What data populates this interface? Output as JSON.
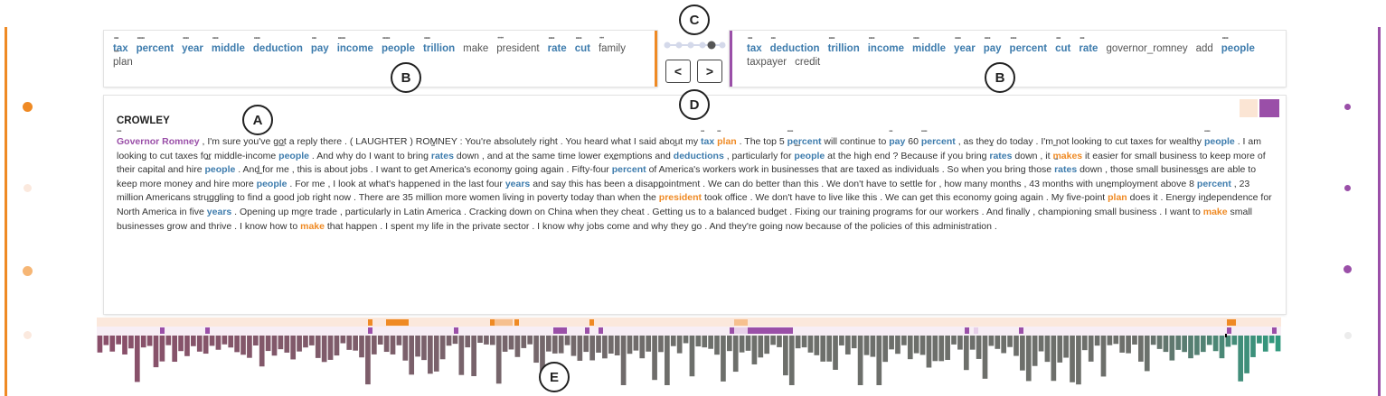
{
  "colors": {
    "orange": "#ef8a24",
    "purple": "#9a4fa8",
    "blue": "#3e7cad",
    "light_orange_bg": "#fbe5d4",
    "light_purple": "#e7cfe9",
    "bar_left": "#8a4f6a",
    "bar_mid": "#6d6f6b",
    "bar_right": "#2e9b7f"
  },
  "callouts": {
    "a": "A",
    "b_left": "B",
    "b_right": "B",
    "c": "C",
    "d": "D",
    "e": "E"
  },
  "left_keywords": [
    {
      "text": "tax",
      "style": "blue",
      "dots": "•••"
    },
    {
      "text": "percent",
      "style": "blue",
      "dots": "•••••"
    },
    {
      "text": "year",
      "style": "blue",
      "dots": "••••"
    },
    {
      "text": "middle",
      "style": "blue",
      "dots": "••••"
    },
    {
      "text": "deduction",
      "style": "blue",
      "dots": "••••"
    },
    {
      "text": "pay",
      "style": "blue",
      "dots": "•••"
    },
    {
      "text": "income",
      "style": "blue",
      "dots": "•••••"
    },
    {
      "text": "people",
      "style": "blue",
      "dots": "•••••"
    },
    {
      "text": "trillion",
      "style": "blue",
      "dots": "••••"
    },
    {
      "text": "make",
      "style": "gray",
      "dots": ""
    },
    {
      "text": "president",
      "style": "gray",
      "dots": "••••"
    },
    {
      "text": "rate",
      "style": "blue",
      "dots": "••••"
    },
    {
      "text": "cut",
      "style": "blue",
      "dots": "••••"
    },
    {
      "text": "family",
      "style": "gray",
      "dots": "•••"
    },
    {
      "text": "plan",
      "style": "gray",
      "dots": "•••"
    }
  ],
  "right_keywords": [
    {
      "text": "tax",
      "style": "blue",
      "dots": "•••"
    },
    {
      "text": "deduction",
      "style": "blue",
      "dots": "•••"
    },
    {
      "text": "trillion",
      "style": "blue",
      "dots": "••••"
    },
    {
      "text": "income",
      "style": "blue",
      "dots": "••••"
    },
    {
      "text": "middle",
      "style": "blue",
      "dots": "••••"
    },
    {
      "text": "year",
      "style": "blue",
      "dots": "••••"
    },
    {
      "text": "pay",
      "style": "blue",
      "dots": "••••"
    },
    {
      "text": "percent",
      "style": "blue",
      "dots": "••••"
    },
    {
      "text": "cut",
      "style": "blue",
      "dots": "•••"
    },
    {
      "text": "rate",
      "style": "blue",
      "dots": "•••"
    },
    {
      "text": "governor_romney",
      "style": "gray",
      "dots": ""
    },
    {
      "text": "add",
      "style": "gray",
      "dots": ""
    },
    {
      "text": "people",
      "style": "blue",
      "dots": "••••"
    },
    {
      "text": "taxpayer",
      "style": "gray",
      "dots": ""
    },
    {
      "text": "credit",
      "style": "gray",
      "dots": ""
    }
  ],
  "nav": {
    "prev_label": "<",
    "next_label": ">"
  },
  "speaker": "CROWLEY",
  "transcript": [
    {
      "t": "Governor Romney",
      "s": "purple",
      "dots": "••••"
    },
    {
      "t": " , I'm sure you've got a reply there . ( LAUGHTER ) ROMNEY : You're absolutely right . You heard what I said about my "
    },
    {
      "t": "tax",
      "s": "blue",
      "dots": "•••"
    },
    {
      "t": "  "
    },
    {
      "t": "plan",
      "s": "orange",
      "dots": "•••"
    },
    {
      "t": "  . The top 5 "
    },
    {
      "t": "percent",
      "s": "blue",
      "dots": "•••••"
    },
    {
      "t": " will continue to "
    },
    {
      "t": "pay",
      "s": "blue",
      "dots": "•••"
    },
    {
      "t": "  60 "
    },
    {
      "t": "percent",
      "s": "blue",
      "dots": "•••••"
    },
    {
      "t": " , as they do today . I'm not looking to cut taxes for wealthy "
    },
    {
      "t": "people",
      "s": "blue",
      "dots": "•••••"
    },
    {
      "t": " . I am looking to cut taxes for middle-income "
    },
    {
      "t": "people",
      "s": "blue",
      "dots": "•••••"
    },
    {
      "t": " . And why do I want to bring "
    },
    {
      "t": "rates",
      "s": "blue",
      "dots": "•••"
    },
    {
      "t": "  down , and at the same time lower exemptions and "
    },
    {
      "t": "deductions",
      "s": "blue",
      "dots": "•••"
    },
    {
      "t": " , particularly for "
    },
    {
      "t": "people",
      "s": "blue",
      "dots": "•••••"
    },
    {
      "t": " at the high end ? Because if you bring "
    },
    {
      "t": "rates",
      "s": "blue",
      "dots": "•••"
    },
    {
      "t": "  down , it "
    },
    {
      "t": "makes",
      "s": "orange",
      "dots": "••••"
    },
    {
      "t": "  it easier for small business to keep more of their capital and hire "
    },
    {
      "t": "people",
      "s": "blue",
      "dots": "•••••"
    },
    {
      "t": " . And for me , this is about jobs . I want to get America's economy going again . Fifty-four "
    },
    {
      "t": "percent",
      "s": "blue",
      "dots": "•••••"
    },
    {
      "t": " of America's workers work in businesses that are taxed as individuals . So when you bring those "
    },
    {
      "t": "rates",
      "s": "blue",
      "dots": "•••"
    },
    {
      "t": "  down , those small businesses are able to keep more money and hire more "
    },
    {
      "t": "people",
      "s": "blue",
      "dots": "•••••"
    },
    {
      "t": " . For me , I look at what's happened in the last four "
    },
    {
      "t": "years",
      "s": "blue",
      "dots": "••••"
    },
    {
      "t": "  and say this has been a disappointment . We can do better than this . We don't have to settle for , how many months , 43 months with unemployment above 8 "
    },
    {
      "t": "percent",
      "s": "blue",
      "dots": "•••••"
    },
    {
      "t": " , 23 million Americans struggling to find a good job right now . There are 35 million more women living in poverty today than when the "
    },
    {
      "t": "president",
      "s": "orange",
      "dots": "••••"
    },
    {
      "t": " took office . We don't have to live like this . We can get this economy going again . My five-point "
    },
    {
      "t": "plan",
      "s": "orange",
      "dots": "•••"
    },
    {
      "t": " does it . Energy independence for North America in five "
    },
    {
      "t": "years",
      "s": "blue",
      "dots": "••••"
    },
    {
      "t": "  . Opening up more trade , particularly in Latin America . Cracking down on China when they cheat . Getting us to a balanced budget . Fixing our training programs for our workers . And finally , championing small business . I want to "
    },
    {
      "t": "make",
      "s": "orange",
      "dots": "••••"
    },
    {
      "t": "  small businesses grow and thrive . I know how to "
    },
    {
      "t": "make",
      "s": "orange",
      "dots": "••••"
    },
    {
      "t": "  that happen . I spent my life in the private sector . I know why jobs come and why they go . And they're going now because of the policies of this administration ."
    }
  ]
}
